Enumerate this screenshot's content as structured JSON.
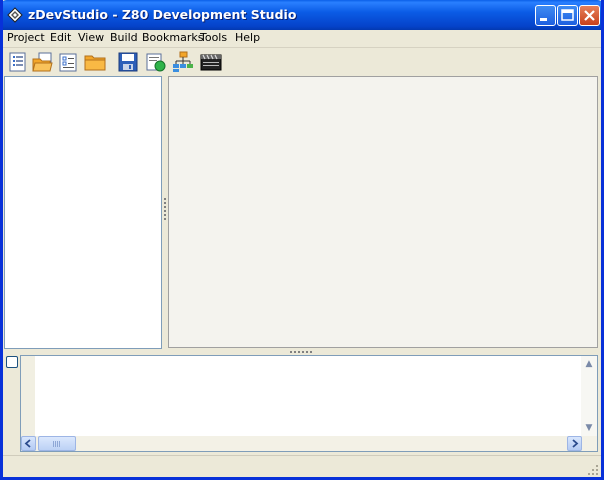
{
  "window": {
    "title": "zDevStudio - Z80 Development Studio",
    "icon": "diamond-app-icon",
    "controls": [
      "minimize-icon",
      "maximize-icon",
      "close-icon"
    ]
  },
  "menubar": {
    "items": [
      "Project",
      "Edit",
      "View",
      "Build",
      "Bookmarks",
      "Tools",
      "Help"
    ]
  },
  "toolbar": {
    "tools": [
      {
        "icon": "new-project-icon"
      },
      {
        "icon": "open-project-icon"
      },
      {
        "icon": "new-file-icon"
      },
      {
        "icon": "open-folder-icon"
      },
      {
        "icon": "save-icon"
      },
      {
        "icon": "build-icon"
      },
      {
        "icon": "project-tree-icon"
      },
      {
        "icon": "terminal-icon"
      }
    ]
  },
  "colors": {
    "titlebar": "#0b5ce6",
    "frame": "#0831d9",
    "face": "#ece9d8"
  }
}
